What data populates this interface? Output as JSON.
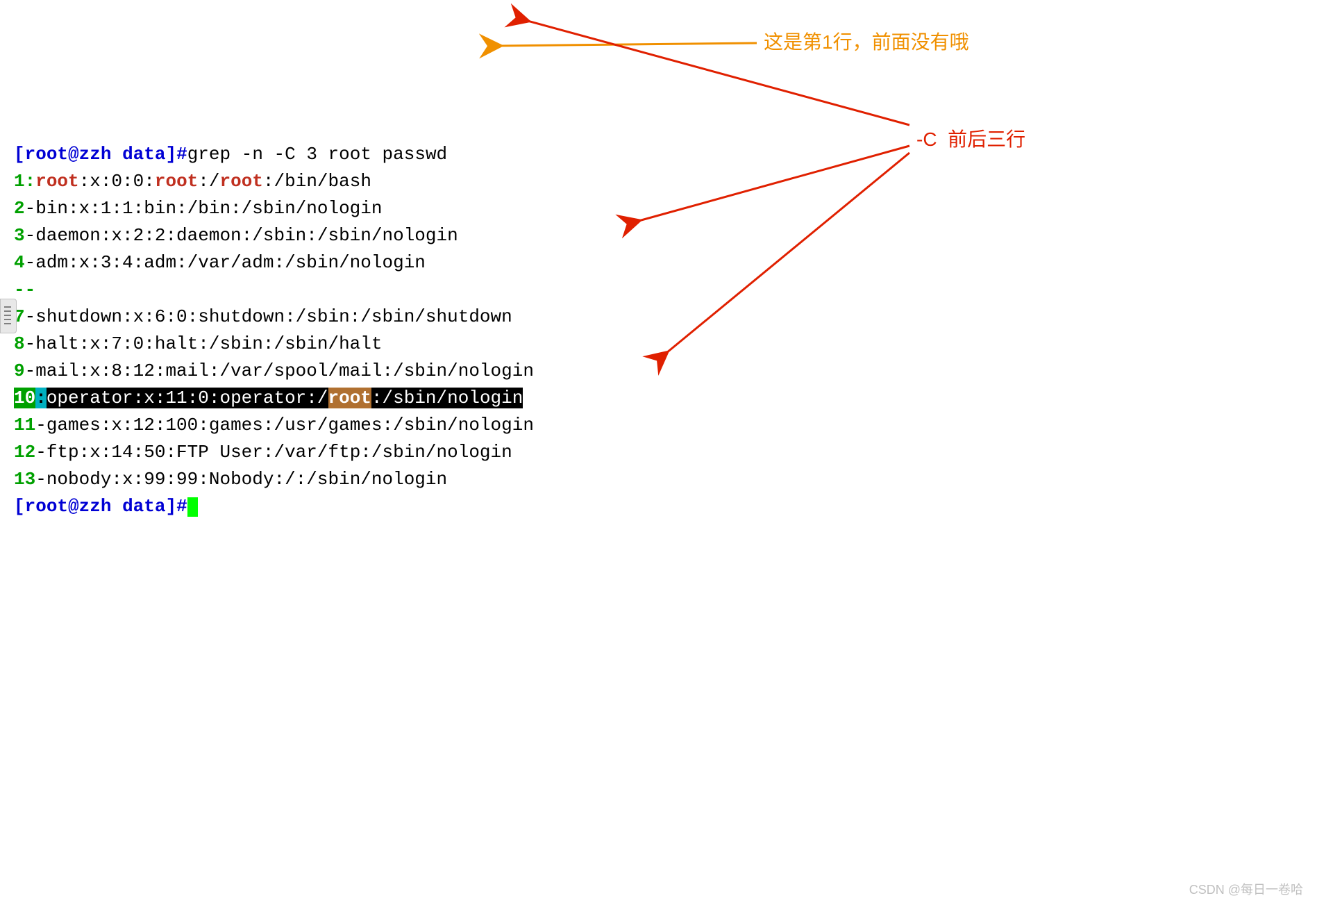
{
  "prompt": {
    "user": "root",
    "host": "zzh",
    "dir": "data",
    "symbol": "#"
  },
  "command": "grep -n -C 3 root passwd",
  "lines": {
    "l1_num": "1",
    "l1_sep": ":",
    "l1_p1": "root",
    "l1_p2": ":x:0:0:",
    "l1_p3": "root",
    "l1_p4": ":/",
    "l1_p5": "root",
    "l1_p6": ":/bin/bash",
    "l2_num": "2",
    "l2_rest": "-bin:x:1:1:bin:/bin:/sbin/nologin",
    "l3_num": "3",
    "l3_rest": "-daemon:x:2:2:daemon:/sbin:/sbin/nologin",
    "l4_num": "4",
    "l4_rest": "-adm:x:3:4:adm:/var/adm:/sbin/nologin",
    "sep": "--",
    "l7_num": "7",
    "l7_rest": "-shutdown:x:6:0:shutdown:/sbin:/sbin/shutdown",
    "l8_num": "8",
    "l8_rest": "-halt:x:7:0:halt:/sbin:/sbin/halt",
    "l9_num": "9",
    "l9_rest": "-mail:x:8:12:mail:/var/spool/mail:/sbin/nologin",
    "l10_num": "10",
    "l10_sep": ":",
    "l10_p1": "operator:x:11:0:operator:/",
    "l10_p2": "root",
    "l10_p3": ":/sbin/nologin",
    "l11_num": "11",
    "l11_rest": "-games:x:12:100:games:/usr/games:/sbin/nologin",
    "l12_num": "12",
    "l12_rest": "-ftp:x:14:50:FTP User:/var/ftp:/sbin/nologin",
    "l13_num": "13",
    "l13_rest": "-nobody:x:99:99:Nobody:/:/sbin/nologin"
  },
  "annotations": {
    "orange": "这是第1行，前面没有哦",
    "red": "-C  前后三行"
  },
  "watermark": "CSDN @每日一卷哈"
}
